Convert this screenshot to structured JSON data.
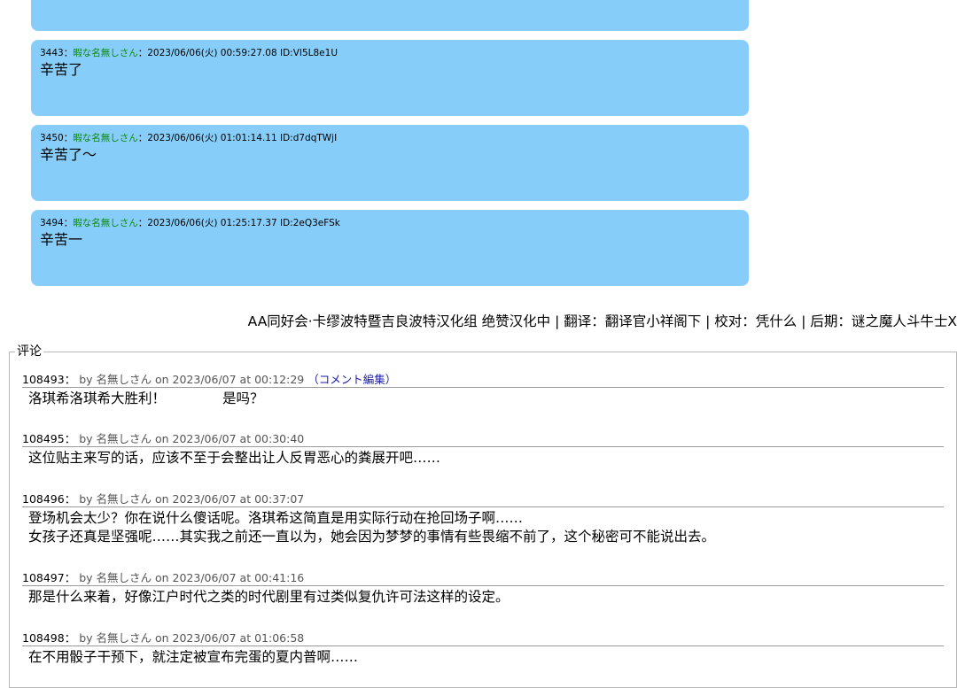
{
  "posts": [
    {
      "num": "3443",
      "sep": "：",
      "name": "暇な名無しさん",
      "meta": "：2023/06/06(火) 00:59:27.08 ID:VI5L8e1U",
      "body": "辛苦了"
    },
    {
      "num": "3450",
      "sep": "：",
      "name": "暇な名無しさん",
      "meta": "：2023/06/06(火) 01:01:14.11 ID:d7dqTWjI",
      "body": "辛苦了～"
    },
    {
      "num": "3494",
      "sep": "：",
      "name": "暇な名無しさん",
      "meta": "：2023/06/06(火) 01:25:17.37 ID:2eQ3eFSk",
      "body": "辛苦一"
    }
  ],
  "credits": "AA同好会·卡缪波特暨吉良波特汉化组 绝赞汉化中 | 翻译：翻译官小祥阁下 | 校对：凭什么 | 后期：谜之魔人斗牛士X",
  "comments_title": "评论",
  "comments": [
    {
      "id": "108493：",
      "by": "by 名無しさん on 2023/06/07 at 00:12:29",
      "edit": "（コメント編集）",
      "body": "洛琪希洛琪希大胜利！             是吗？"
    },
    {
      "id": "108495：",
      "by": "by 名無しさん on 2023/06/07 at 00:30:40",
      "edit": "",
      "body": "这位贴主来写的话，应该不至于会整出让人反胃恶心的粪展开吧……"
    },
    {
      "id": "108496：",
      "by": "by 名無しさん on 2023/06/07 at 00:37:07",
      "edit": "",
      "body": "登场机会太少？你在说什么傻话呢。洛琪希这简直是用实际行动在抢回场子啊……\n女孩子还真是坚强呢……其实我之前还一直以为，她会因为梦梦的事情有些畏缩不前了，这个秘密可不能说出去。"
    },
    {
      "id": "108497：",
      "by": "by 名無しさん on 2023/06/07 at 00:41:16",
      "edit": "",
      "body": "那是什么来着，好像江户时代之类的时代剧里有过类似复仇许可法这样的设定。"
    },
    {
      "id": "108498：",
      "by": "by 名無しさん on 2023/06/07 at 01:06:58",
      "edit": "",
      "body": "在不用骰子干预下，就注定被宣布完蛋的夏内普啊……"
    }
  ]
}
